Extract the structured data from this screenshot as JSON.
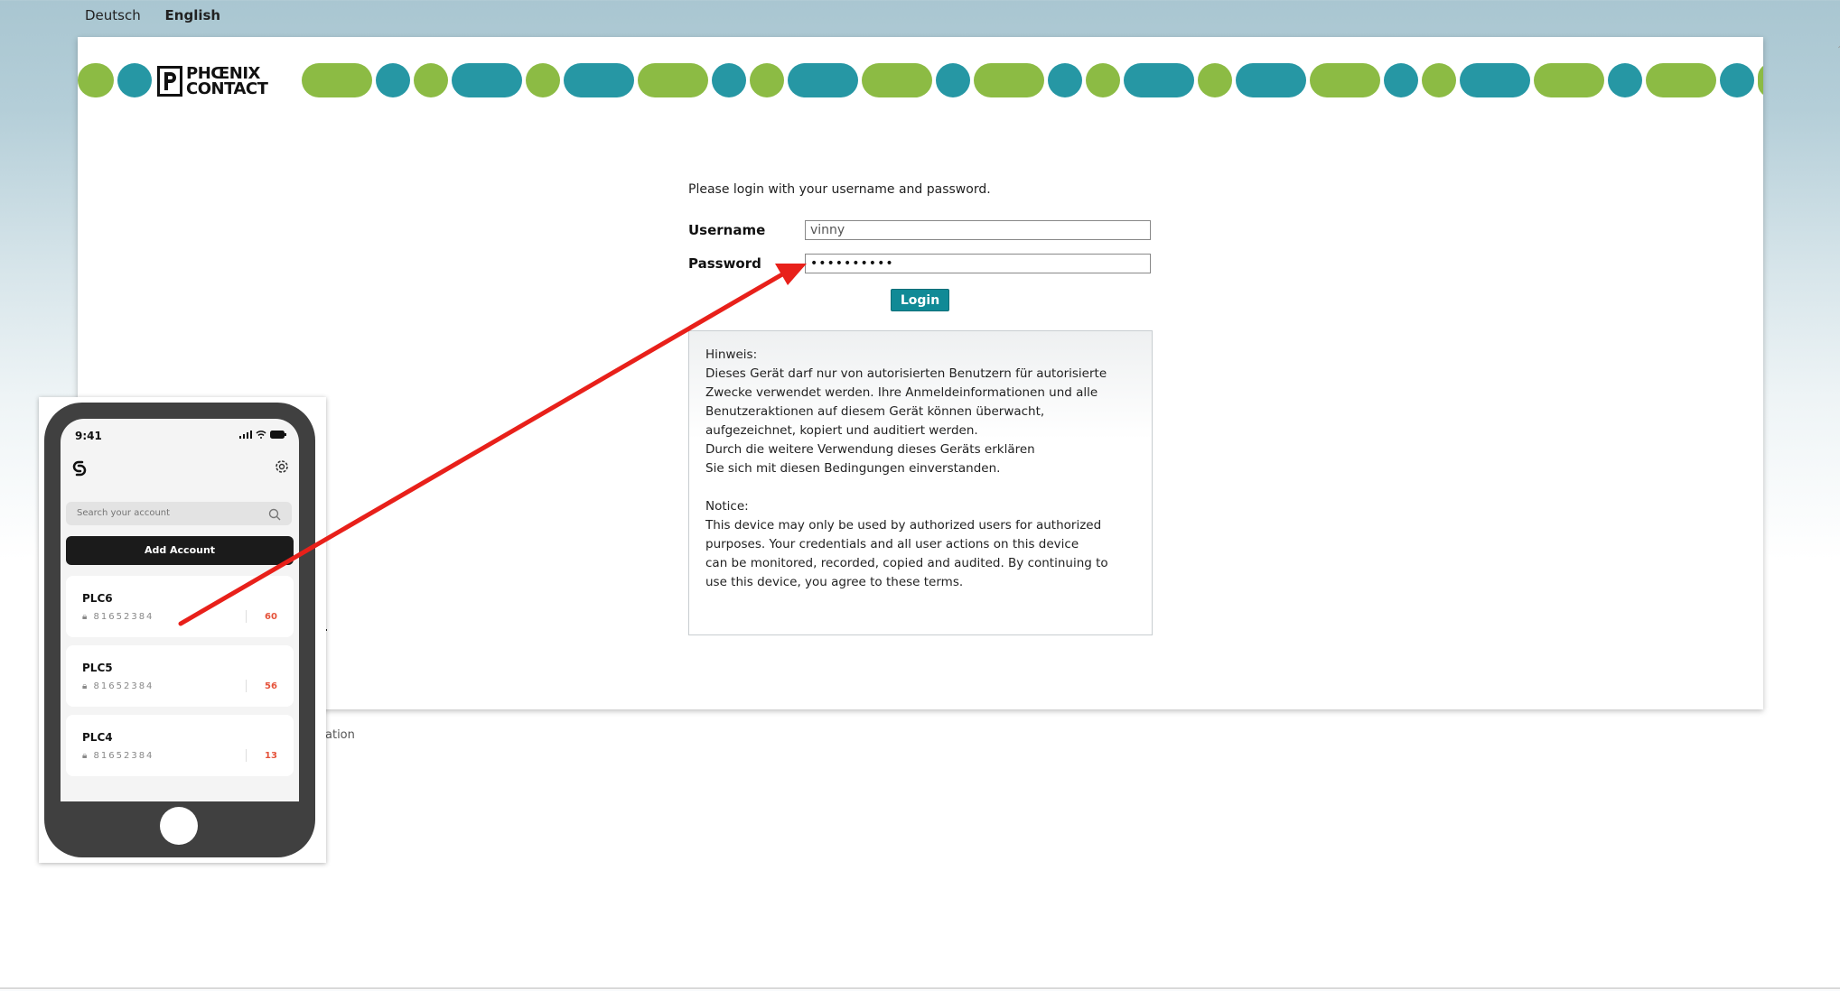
{
  "language": {
    "items": [
      "Deutsch",
      "English"
    ],
    "active": "English"
  },
  "brand": {
    "line1": "PHŒNIX",
    "line2": "CONTACT"
  },
  "login": {
    "intro": "Please login with your username and password.",
    "username_label": "Username",
    "username_value": "vinny",
    "password_label": "Password",
    "password_value": "••••••••••",
    "button": "Login"
  },
  "notice": {
    "de_title": "Hinweis:",
    "de_lines": [
      "Dieses Gerät darf nur von autorisierten Benutzern für autorisierte",
      "Zwecke verwendet werden. Ihre Anmeldeinformationen und alle",
      "Benutzeraktionen auf diesem Gerät können überwacht,",
      "aufgezeichnet, kopiert und auditiert werden.",
      "Durch die weitere Verwendung dieses Geräts erklären",
      "Sie sich mit diesen Bedingungen einverstanden."
    ],
    "en_title": "Notice:",
    "en_lines": [
      "This device may only be used by authorized users for authorized",
      "purposes. Your credentials and all user actions on this device",
      "can be monitored, recorded, copied and audited. By continuing to",
      "use this device, you agree to these terms."
    ]
  },
  "footer_fragment": "ation",
  "phone": {
    "time": "9:41",
    "search_placeholder": "Search your account",
    "add_button": "Add Account",
    "accounts": [
      {
        "name": "PLC6",
        "code": "81652384",
        "count": "60"
      },
      {
        "name": "PLC5",
        "code": "81652384",
        "count": "56"
      },
      {
        "name": "PLC4",
        "code": "81652384",
        "count": "13"
      }
    ]
  },
  "colors": {
    "accent_green": "#8cbb44",
    "accent_teal": "#2697a4",
    "button_teal": "#108a96",
    "arrow": "#e8201a"
  }
}
